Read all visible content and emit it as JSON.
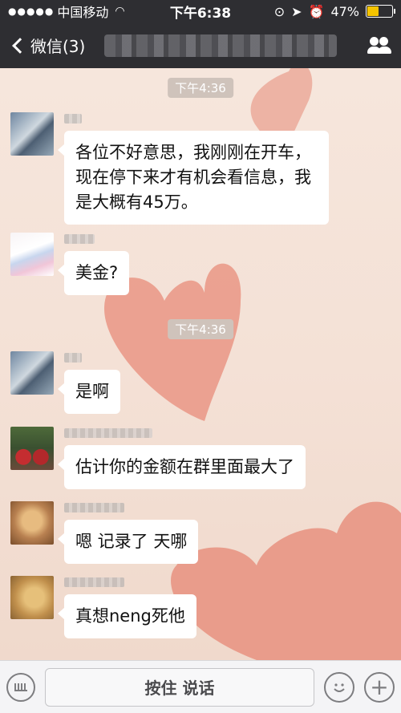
{
  "status_bar": {
    "carrier": "中国移动",
    "time": "下午6:38",
    "battery_percent": "47%",
    "battery_level": 0.47
  },
  "nav": {
    "back_label": "微信(3)"
  },
  "timestamps": [
    "下午4:36",
    "下午4:36"
  ],
  "messages": [
    {
      "text": "各位不好意思，我刚刚在开车，现在停下来才有机会看信息，我是大概有45万。"
    },
    {
      "text": "美金?"
    },
    {
      "text": "是啊"
    },
    {
      "text": "估计你的金额在群里面最大了"
    },
    {
      "text": "嗯 记录了 天哪"
    },
    {
      "text": "真想neng死他"
    }
  ],
  "input_bar": {
    "hold_to_talk": "按住 说话"
  },
  "colors": {
    "nav_bg": "#2e2e32",
    "heart": "#e8917f",
    "battery": "#f5c400"
  }
}
